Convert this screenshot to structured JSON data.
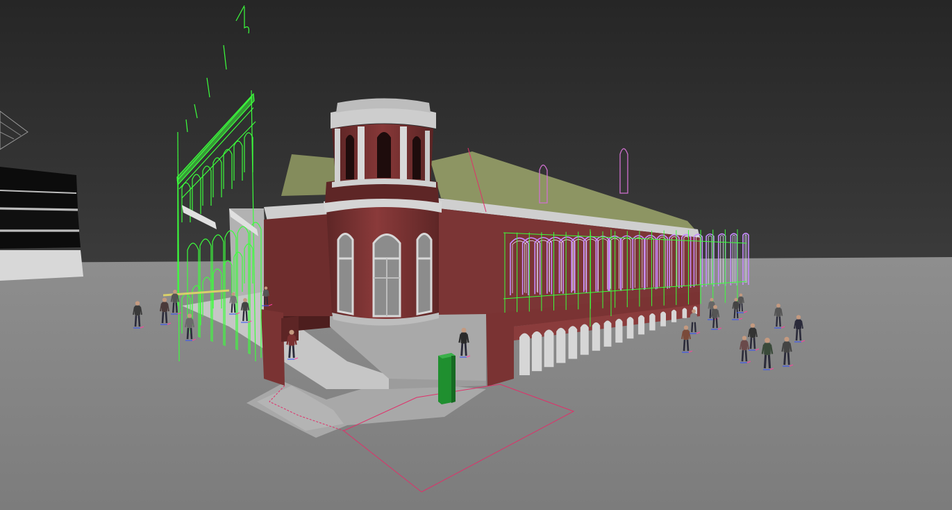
{
  "viewport": {
    "label": "",
    "shading": "shaded",
    "colors": {
      "sky_top": "#262626",
      "sky_bottom": "#3a3a3a",
      "ground": "#8a8a8a",
      "brick": "#7a3434",
      "brick_dark": "#5e2626",
      "roof": "#8b9460",
      "trim": "#cfcfcf",
      "wire_green": "#3cff3c",
      "wire_purple": "#c88cff",
      "wire_red": "#e0306a",
      "bin": "#1f8f2f"
    }
  },
  "scene": {
    "objects": [
      {
        "name": "building-main",
        "type": "mesh"
      },
      {
        "name": "tower",
        "type": "mesh"
      },
      {
        "name": "facade-wireframe",
        "type": "wireframe"
      },
      {
        "name": "arcade-wireframe",
        "type": "wireframe"
      },
      {
        "name": "selection-outline",
        "type": "spline"
      },
      {
        "name": "crowd",
        "type": "group"
      },
      {
        "name": "green-bin",
        "type": "mesh"
      }
    ]
  }
}
